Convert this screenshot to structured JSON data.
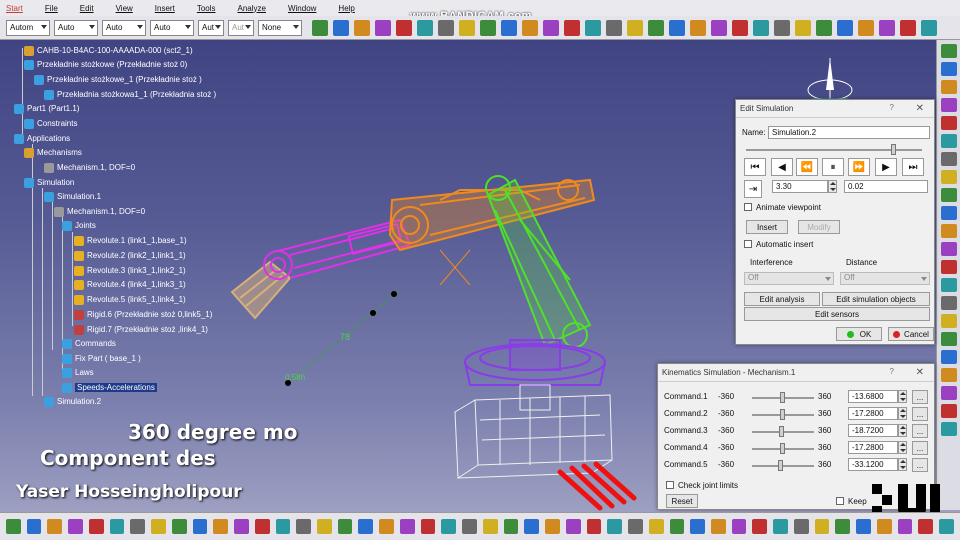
{
  "menu": [
    "Start",
    "File",
    "Edit",
    "View",
    "Insert",
    "Tools",
    "Analyze",
    "Window",
    "Help"
  ],
  "watermark": "www.BANDICAM.com",
  "toolbar": {
    "combos": [
      "Autom",
      "Auto",
      "Auto",
      "Auto",
      "Aut",
      "Aut",
      "None"
    ]
  },
  "tree": {
    "nodes": [
      {
        "label": "CAHB-10-B4AC-100-AAAADA-000 (sct2_1)"
      },
      {
        "label": "Przekładnie stożkowe (Przekładnie stoż        0)"
      },
      {
        "label": "Przekładnie stożkowe_1 (Przekładnie stoż         )"
      },
      {
        "label": "Przekładnia stożkowa1_1 (Przekładnia stoż          )"
      },
      {
        "label": "Part1 (Part1.1)"
      },
      {
        "label": "Constraints"
      },
      {
        "label": "Applications"
      },
      {
        "label": "Mechanisms"
      },
      {
        "label": "Mechanism.1, DOF=0"
      },
      {
        "label": "Simulation"
      },
      {
        "label": "Simulation.1"
      },
      {
        "label": "Mechanism.1, DOF=0"
      },
      {
        "label": "Joints"
      },
      {
        "label": "Revolute.1 (link1_1,base_1)"
      },
      {
        "label": "Revolute.2 (link2_1,link1_1)"
      },
      {
        "label": "Revolute.3 (link3_1,link2_1)"
      },
      {
        "label": "Revolute.4 (link4_1,link3_1)"
      },
      {
        "label": "Revolute.5 (link5_1,link4_1)"
      },
      {
        "label": "Rigid.6 (Przekładnie stoż         0,link5_1)"
      },
      {
        "label": "Rigid.7 (Przekładnie stoż           ,link4_1)"
      },
      {
        "label": "Commands"
      },
      {
        "label": "Fix Part ( base_1 )"
      },
      {
        "label": "Laws"
      },
      {
        "label": "Speeds-Accelerations"
      },
      {
        "label": "Simulation.2"
      }
    ]
  },
  "viewport": {
    "dim1": "78",
    "dim2": "0.58h"
  },
  "captions": {
    "line1": "360 degree mo",
    "line2": "Component des",
    "author": "Yaser Hosseingholipour"
  },
  "edit_simulation": {
    "title": "Edit Simulation",
    "help": "?",
    "close": "✕",
    "name_label": "Name:",
    "name_value": "Simulation.2",
    "time_value": "3.30",
    "step_value": "0.02",
    "animate_viewpoint": "Animate viewpoint",
    "insert": "Insert",
    "modify": "Modify",
    "automatic_insert": "Automatic insert",
    "interference_label": "Interference",
    "interference_value": "Off",
    "distance_label": "Distance",
    "distance_value": "Off",
    "edit_analysis": "Edit analysis",
    "edit_simulation_objects": "Edit simulation objects",
    "edit_sensors": "Edit sensors",
    "ok": "OK",
    "cancel": "Cancel"
  },
  "kinematics": {
    "title": "Kinematics Simulation - Mechanism.1",
    "help": "?",
    "close": "✕",
    "commands": [
      {
        "name": "Command.1",
        "min": "-360",
        "max": "360",
        "value": "-13.6800",
        "level": -13.68
      },
      {
        "name": "Command.2",
        "min": "-360",
        "max": "360",
        "value": "-17.2800",
        "level": -17.28
      },
      {
        "name": "Command.3",
        "min": "-360",
        "max": "360",
        "value": "-18.7200",
        "level": -18.72
      },
      {
        "name": "Command.4",
        "min": "-360",
        "max": "360",
        "value": "-17.2800",
        "level": -17.28
      },
      {
        "name": "Command.5",
        "min": "-360",
        "max": "360",
        "value": "-33.1200",
        "level": -33.12
      }
    ],
    "more": "...",
    "check_joint_limits": "Check joint limits",
    "reset": "Reset",
    "keep": "Keep"
  },
  "colors": {
    "background_top": "#3c3f7e",
    "background_bottom": "#a6a8c6",
    "link_orange": "#f08a1c",
    "link_green": "#4fe02a",
    "link_magenta": "#e030e8",
    "link_tan": "#d8b07a",
    "base_purple": "#8a3ce8",
    "base_white": "#f0f0f0",
    "gripper_red": "#f01010"
  }
}
